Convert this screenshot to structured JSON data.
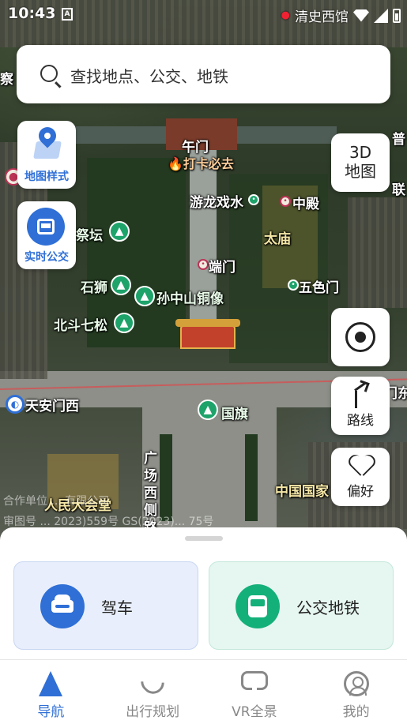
{
  "status_bar": {
    "time": "10:43",
    "location": "清史西馆"
  },
  "search": {
    "placeholder": "查找地点、公交、地铁"
  },
  "map_controls": {
    "map_style_label": "地图样式",
    "realtime_bus_label": "实时公交",
    "map3d_line1": "3D",
    "map3d_line2": "地图",
    "route_label": "路线",
    "favorites_label": "偏好"
  },
  "map_labels": {
    "wumen": "午门",
    "checkin": "打卡必去",
    "youlong": "游龙戏水",
    "zhongdian": "中殿",
    "taimiao": "太庙",
    "duanmen": "端门",
    "wuse": "五色门",
    "jitan": "祭坛",
    "shishi": "石狮",
    "zhongshan": "孙中山铜像",
    "beidou": "北斗七松",
    "tiananmen_west": "天安门西",
    "east_partial": "门东",
    "guoqi": "国旗",
    "guangchang": "广场西侧路",
    "renmin": "人民大会堂",
    "museum": "中国国家",
    "partial_left": "察",
    "partial_right_top": "普",
    "partial_right_lian": "联",
    "copyright_1": "合作单位 ... 有限公司",
    "copyright_2": "审图号 ... 2023)559号  GS(2023)... 75号"
  },
  "transport_modes": {
    "drive_label": "驾车",
    "transit_label": "公交地铁"
  },
  "tabs": [
    {
      "label": "导航",
      "active": true
    },
    {
      "label": "出行规划",
      "active": false
    },
    {
      "label": "VR全景",
      "active": false
    },
    {
      "label": "我的",
      "active": false
    }
  ],
  "colors": {
    "accent": "#2f6fd6",
    "transit": "#14b07a"
  }
}
